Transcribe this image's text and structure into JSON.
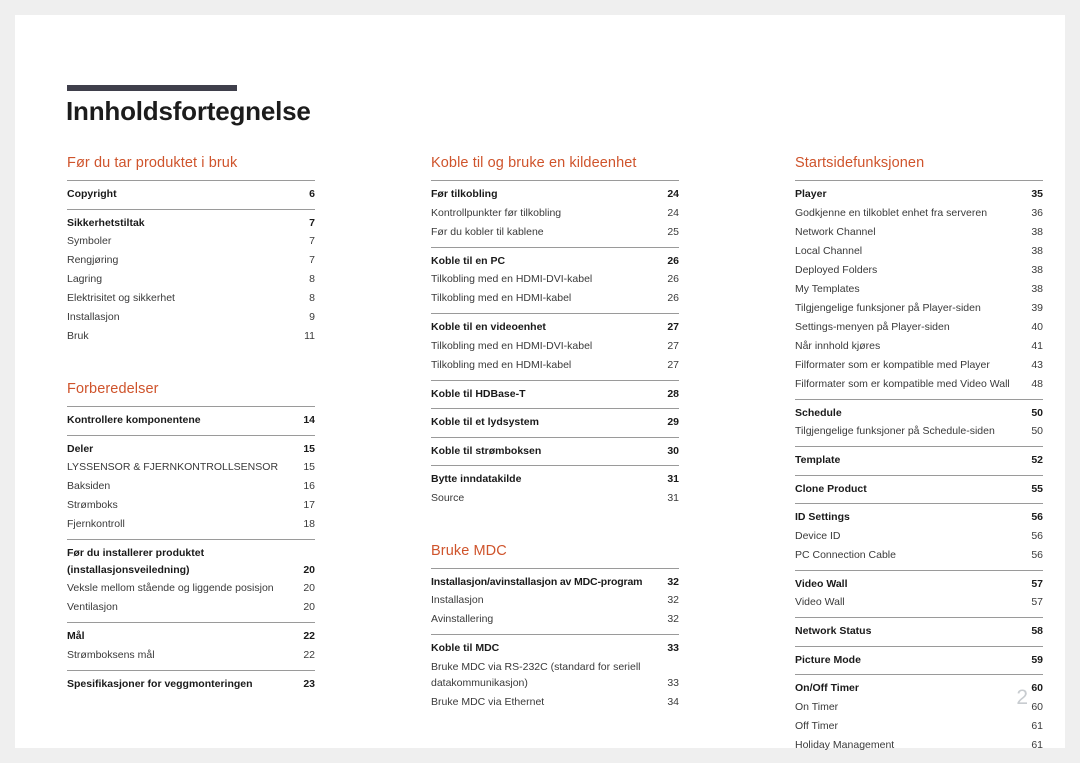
{
  "document": {
    "title": "Innholdsfortegnelse",
    "folio": "2",
    "accent_color": "#cf542c",
    "rule_color": "#3f3f4b",
    "folio_color": "#c8ccd0"
  },
  "columns": [
    {
      "id": "column-1",
      "sections": [
        {
          "title": "Før du tar produktet i bruk",
          "groups": [
            {
              "entries": [
                {
                  "label": "Copyright",
                  "page": "6",
                  "level": "head"
                }
              ]
            },
            {
              "entries": [
                {
                  "label": "Sikkerhetstiltak",
                  "page": "7",
                  "level": "head"
                },
                {
                  "label": "Symboler",
                  "page": "7",
                  "level": "sub"
                },
                {
                  "label": "Rengjøring",
                  "page": "7",
                  "level": "sub"
                },
                {
                  "label": "Lagring",
                  "page": "8",
                  "level": "sub"
                },
                {
                  "label": "Elektrisitet og sikkerhet",
                  "page": "8",
                  "level": "sub"
                },
                {
                  "label": "Installasjon",
                  "page": "9",
                  "level": "sub"
                },
                {
                  "label": "Bruk",
                  "page": "11",
                  "level": "sub"
                }
              ]
            }
          ]
        },
        {
          "title": "Forberedelser",
          "groups": [
            {
              "entries": [
                {
                  "label": "Kontrollere komponentene",
                  "page": "14",
                  "level": "head"
                }
              ]
            },
            {
              "entries": [
                {
                  "label": "Deler",
                  "page": "15",
                  "level": "head"
                },
                {
                  "label": "LYSSENSOR & FJERNKONTROLLSENSOR",
                  "page": "15",
                  "level": "sub"
                },
                {
                  "label": "Baksiden",
                  "page": "16",
                  "level": "sub"
                },
                {
                  "label": "Strømboks",
                  "page": "17",
                  "level": "sub"
                },
                {
                  "label": "Fjernkontroll",
                  "page": "18",
                  "level": "sub"
                }
              ]
            },
            {
              "entries": [
                {
                  "label": "Før du installerer produktet (installasjonsveiledning)",
                  "page": "20",
                  "level": "head",
                  "multiline": true
                },
                {
                  "label": "Veksle mellom stående og liggende posisjon",
                  "page": "20",
                  "level": "sub"
                },
                {
                  "label": "Ventilasjon",
                  "page": "20",
                  "level": "sub"
                }
              ]
            },
            {
              "entries": [
                {
                  "label": "Mål",
                  "page": "22",
                  "level": "head"
                },
                {
                  "label": "Strømboksens mål",
                  "page": "22",
                  "level": "sub"
                }
              ]
            },
            {
              "entries": [
                {
                  "label": "Spesifikasjoner for veggmonteringen",
                  "page": "23",
                  "level": "head"
                }
              ]
            }
          ]
        }
      ]
    },
    {
      "id": "column-2",
      "sections": [
        {
          "title": "Koble til og bruke en kildeenhet",
          "groups": [
            {
              "entries": [
                {
                  "label": "Før tilkobling",
                  "page": "24",
                  "level": "head"
                },
                {
                  "label": "Kontrollpunkter før tilkobling",
                  "page": "24",
                  "level": "sub"
                },
                {
                  "label": "Før du kobler til kablene",
                  "page": "25",
                  "level": "sub"
                }
              ]
            },
            {
              "entries": [
                {
                  "label": "Koble til en PC",
                  "page": "26",
                  "level": "head"
                },
                {
                  "label": "Tilkobling med en HDMI-DVI-kabel",
                  "page": "26",
                  "level": "sub"
                },
                {
                  "label": "Tilkobling med en HDMI-kabel",
                  "page": "26",
                  "level": "sub"
                }
              ]
            },
            {
              "entries": [
                {
                  "label": "Koble til en videoenhet",
                  "page": "27",
                  "level": "head"
                },
                {
                  "label": "Tilkobling med en HDMI-DVI-kabel",
                  "page": "27",
                  "level": "sub"
                },
                {
                  "label": "Tilkobling med en HDMI-kabel",
                  "page": "27",
                  "level": "sub"
                }
              ]
            },
            {
              "entries": [
                {
                  "label": "Koble til HDBase-T",
                  "page": "28",
                  "level": "head"
                }
              ]
            },
            {
              "entries": [
                {
                  "label": "Koble til et lydsystem",
                  "page": "29",
                  "level": "head"
                }
              ]
            },
            {
              "entries": [
                {
                  "label": "Koble til strømboksen",
                  "page": "30",
                  "level": "head"
                }
              ]
            },
            {
              "entries": [
                {
                  "label": "Bytte inndatakilde",
                  "page": "31",
                  "level": "head"
                },
                {
                  "label": "Source",
                  "page": "31",
                  "level": "sub"
                }
              ]
            }
          ]
        },
        {
          "title": "Bruke MDC",
          "groups": [
            {
              "entries": [
                {
                  "label": "Installasjon/avinstallasjon av MDC-program",
                  "page": "32",
                  "level": "head",
                  "tight": true
                },
                {
                  "label": "Installasjon",
                  "page": "32",
                  "level": "sub"
                },
                {
                  "label": "Avinstallering",
                  "page": "32",
                  "level": "sub"
                }
              ]
            },
            {
              "entries": [
                {
                  "label": "Koble til MDC",
                  "page": "33",
                  "level": "head"
                },
                {
                  "label": "Bruke MDC via RS-232C (standard for seriell datakommunikasjon)",
                  "page": "33",
                  "level": "sub",
                  "multiline": true
                },
                {
                  "label": "Bruke MDC via Ethernet",
                  "page": "34",
                  "level": "sub"
                }
              ]
            }
          ]
        }
      ]
    },
    {
      "id": "column-3",
      "sections": [
        {
          "title": "Startsidefunksjonen",
          "groups": [
            {
              "entries": [
                {
                  "label": "Player",
                  "page": "35",
                  "level": "head"
                },
                {
                  "label": "Godkjenne en tilkoblet enhet fra serveren",
                  "page": "36",
                  "level": "sub"
                },
                {
                  "label": "Network Channel",
                  "page": "38",
                  "level": "sub"
                },
                {
                  "label": "Local Channel",
                  "page": "38",
                  "level": "sub"
                },
                {
                  "label": "Deployed Folders",
                  "page": "38",
                  "level": "sub"
                },
                {
                  "label": "My Templates",
                  "page": "38",
                  "level": "sub"
                },
                {
                  "label": "Tilgjengelige funksjoner på Player-siden",
                  "page": "39",
                  "level": "sub"
                },
                {
                  "label": "Settings-menyen på Player-siden",
                  "page": "40",
                  "level": "sub"
                },
                {
                  "label": "Når innhold kjøres",
                  "page": "41",
                  "level": "sub"
                },
                {
                  "label": "Filformater som er kompatible med Player",
                  "page": "43",
                  "level": "sub"
                },
                {
                  "label": "Filformater som er kompatible med Video Wall",
                  "page": "48",
                  "level": "sub"
                }
              ]
            },
            {
              "entries": [
                {
                  "label": "Schedule",
                  "page": "50",
                  "level": "head"
                },
                {
                  "label": "Tilgjengelige funksjoner på Schedule-siden",
                  "page": "50",
                  "level": "sub"
                }
              ]
            },
            {
              "entries": [
                {
                  "label": "Template",
                  "page": "52",
                  "level": "head"
                }
              ]
            },
            {
              "entries": [
                {
                  "label": "Clone Product",
                  "page": "55",
                  "level": "head"
                }
              ]
            },
            {
              "entries": [
                {
                  "label": "ID Settings",
                  "page": "56",
                  "level": "head"
                },
                {
                  "label": "Device ID",
                  "page": "56",
                  "level": "sub"
                },
                {
                  "label": "PC Connection Cable",
                  "page": "56",
                  "level": "sub"
                }
              ]
            },
            {
              "entries": [
                {
                  "label": "Video Wall",
                  "page": "57",
                  "level": "head"
                },
                {
                  "label": "Video Wall",
                  "page": "57",
                  "level": "sub"
                }
              ]
            },
            {
              "entries": [
                {
                  "label": "Network Status",
                  "page": "58",
                  "level": "head"
                }
              ]
            },
            {
              "entries": [
                {
                  "label": "Picture Mode",
                  "page": "59",
                  "level": "head"
                }
              ]
            },
            {
              "entries": [
                {
                  "label": "On/Off Timer",
                  "page": "60",
                  "level": "head"
                },
                {
                  "label": "On Timer",
                  "page": "60",
                  "level": "sub"
                },
                {
                  "label": "Off Timer",
                  "page": "61",
                  "level": "sub"
                },
                {
                  "label": "Holiday Management",
                  "page": "61",
                  "level": "sub"
                }
              ]
            }
          ]
        }
      ]
    }
  ]
}
